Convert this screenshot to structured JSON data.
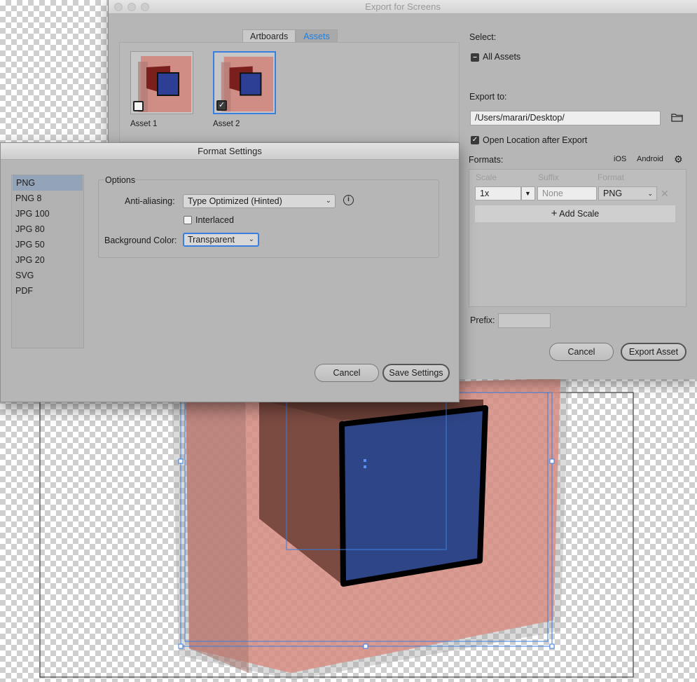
{
  "export_window": {
    "title": "Export for Screens",
    "tabs": [
      {
        "label": "Artboards",
        "active": false
      },
      {
        "label": "Assets",
        "active": true
      }
    ],
    "assets": [
      {
        "label": "Asset 1",
        "checked": false
      },
      {
        "label": "Asset 2",
        "checked": true
      }
    ],
    "select_label": "Select:",
    "all_assets_label": "All Assets",
    "export_to_label": "Export to:",
    "export_path": "/Users/marari/Desktop/",
    "open_location_label": "Open Location after Export",
    "open_location_checked": true,
    "formats_label": "Formats:",
    "ios_label": "iOS",
    "android_label": "Android",
    "columns": {
      "scale": "Scale",
      "suffix": "Suffix",
      "format": "Format"
    },
    "scale_value": "1x",
    "suffix_placeholder": "None",
    "format_value": "PNG",
    "add_scale_label": "Add Scale",
    "prefix_label": "Prefix:",
    "cancel_label": "Cancel",
    "export_asset_label": "Export Asset"
  },
  "format_dialog": {
    "title": "Format Settings",
    "formats": [
      "PNG",
      "PNG 8",
      "JPG 100",
      "JPG 80",
      "JPG 50",
      "JPG 20",
      "SVG",
      "PDF"
    ],
    "selected_format": "PNG",
    "options_label": "Options",
    "anti_aliasing_label": "Anti-aliasing:",
    "anti_aliasing_value": "Type Optimized (Hinted)",
    "interlaced_label": "Interlaced",
    "interlaced_checked": false,
    "background_color_label": "Background Color:",
    "background_color_value": "Transparent",
    "cancel_label": "Cancel",
    "save_label": "Save Settings"
  },
  "colors": {
    "accent_blue": "#3a7fe0",
    "tab_active_text": "#1f7fe0",
    "cube_front": "#2e4587",
    "cube_side": "#7b4a40",
    "outer_shape": "#d98b80"
  }
}
